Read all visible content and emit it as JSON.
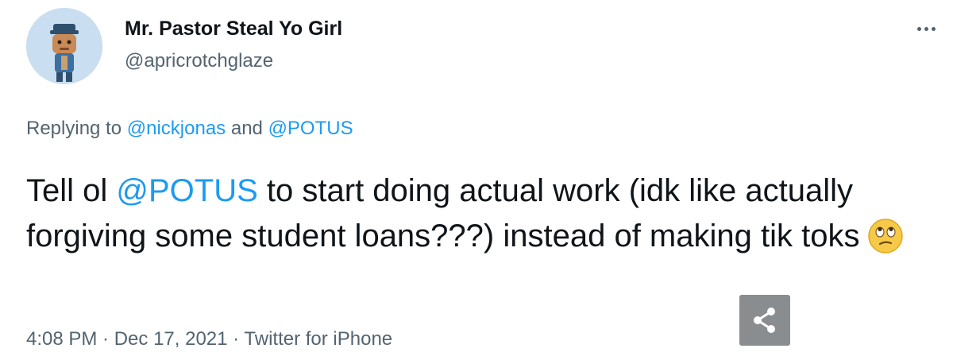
{
  "user": {
    "display_name": "Mr. Pastor Steal Yo Girl",
    "handle": "@apricrotchglaze",
    "avatar_icon": "cartoon-character-avatar"
  },
  "reply": {
    "prefix": "Replying to ",
    "mention_1": "@nickjonas",
    "conjunction": " and ",
    "mention_2": "@POTUS"
  },
  "tweet": {
    "text_before": "Tell ol ",
    "mention": "@POTUS",
    "text_after": " to start doing actual work (idk like actually forgiving some student loans???) instead of making tik toks",
    "emoji_icon": "face-with-rolling-eyes-emoji"
  },
  "meta": {
    "time": "4:08 PM",
    "separator_1": " · ",
    "date": "Dec 17, 2021",
    "separator_2": " · ",
    "source": "Twitter for iPhone"
  },
  "icons": {
    "more": "more-options-icon",
    "share": "share-icon"
  },
  "colors": {
    "link": "#1d9bf0",
    "secondary_text": "#536471",
    "primary_text": "#0f1419",
    "avatar_bg": "#c9def0",
    "share_bg": "#8a8d90"
  }
}
